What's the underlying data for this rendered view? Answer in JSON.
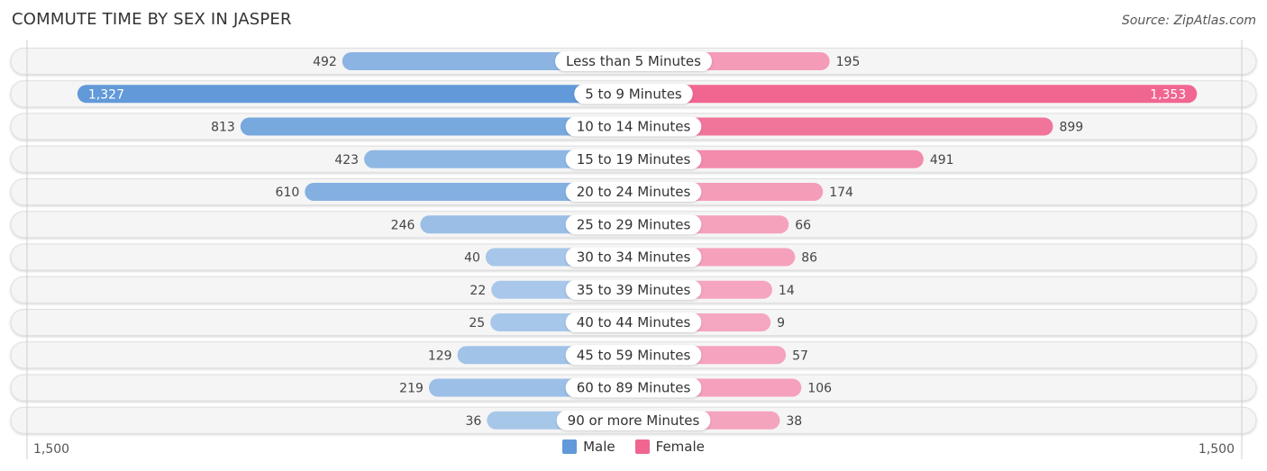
{
  "header": {
    "title": "COMMUTE TIME BY SEX IN JASPER",
    "source": "Source: ZipAtlas.com"
  },
  "colors": {
    "male_strong": "#6199d9",
    "male_light": "#a9c8ea",
    "female_strong": "#f06690",
    "female_light": "#f5a6c0",
    "row_bg": "#f5f5f5",
    "row_border": "#e0e0e0"
  },
  "legend": {
    "items": [
      {
        "label": "Male",
        "color": "#6199d9"
      },
      {
        "label": "Female",
        "color": "#f06690"
      }
    ]
  },
  "chart_data": {
    "type": "bar",
    "orientation": "horizontal-diverging",
    "title": "COMMUTE TIME BY SEX IN JASPER",
    "xlabel": "",
    "ylabel": "",
    "xlim": [
      -1500,
      1500
    ],
    "axis_tick_labels": {
      "left": "1,500",
      "right": "1,500"
    },
    "legend_position": "bottom-center",
    "categories": [
      "Less than 5 Minutes",
      "5 to 9 Minutes",
      "10 to 14 Minutes",
      "15 to 19 Minutes",
      "20 to 24 Minutes",
      "25 to 29 Minutes",
      "30 to 34 Minutes",
      "35 to 39 Minutes",
      "40 to 44 Minutes",
      "45 to 59 Minutes",
      "60 to 89 Minutes",
      "90 or more Minutes"
    ],
    "series": [
      {
        "name": "Male",
        "side": "left",
        "values": [
          492,
          1327,
          813,
          423,
          610,
          246,
          40,
          22,
          25,
          129,
          219,
          36
        ],
        "labels": [
          "492",
          "1,327",
          "813",
          "423",
          "610",
          "246",
          "40",
          "22",
          "25",
          "129",
          "219",
          "36"
        ]
      },
      {
        "name": "Female",
        "side": "right",
        "values": [
          195,
          1353,
          899,
          491,
          174,
          66,
          86,
          14,
          9,
          57,
          106,
          38
        ],
        "labels": [
          "195",
          "1,353",
          "899",
          "491",
          "174",
          "66",
          "86",
          "14",
          "9",
          "57",
          "106",
          "38"
        ]
      }
    ]
  }
}
